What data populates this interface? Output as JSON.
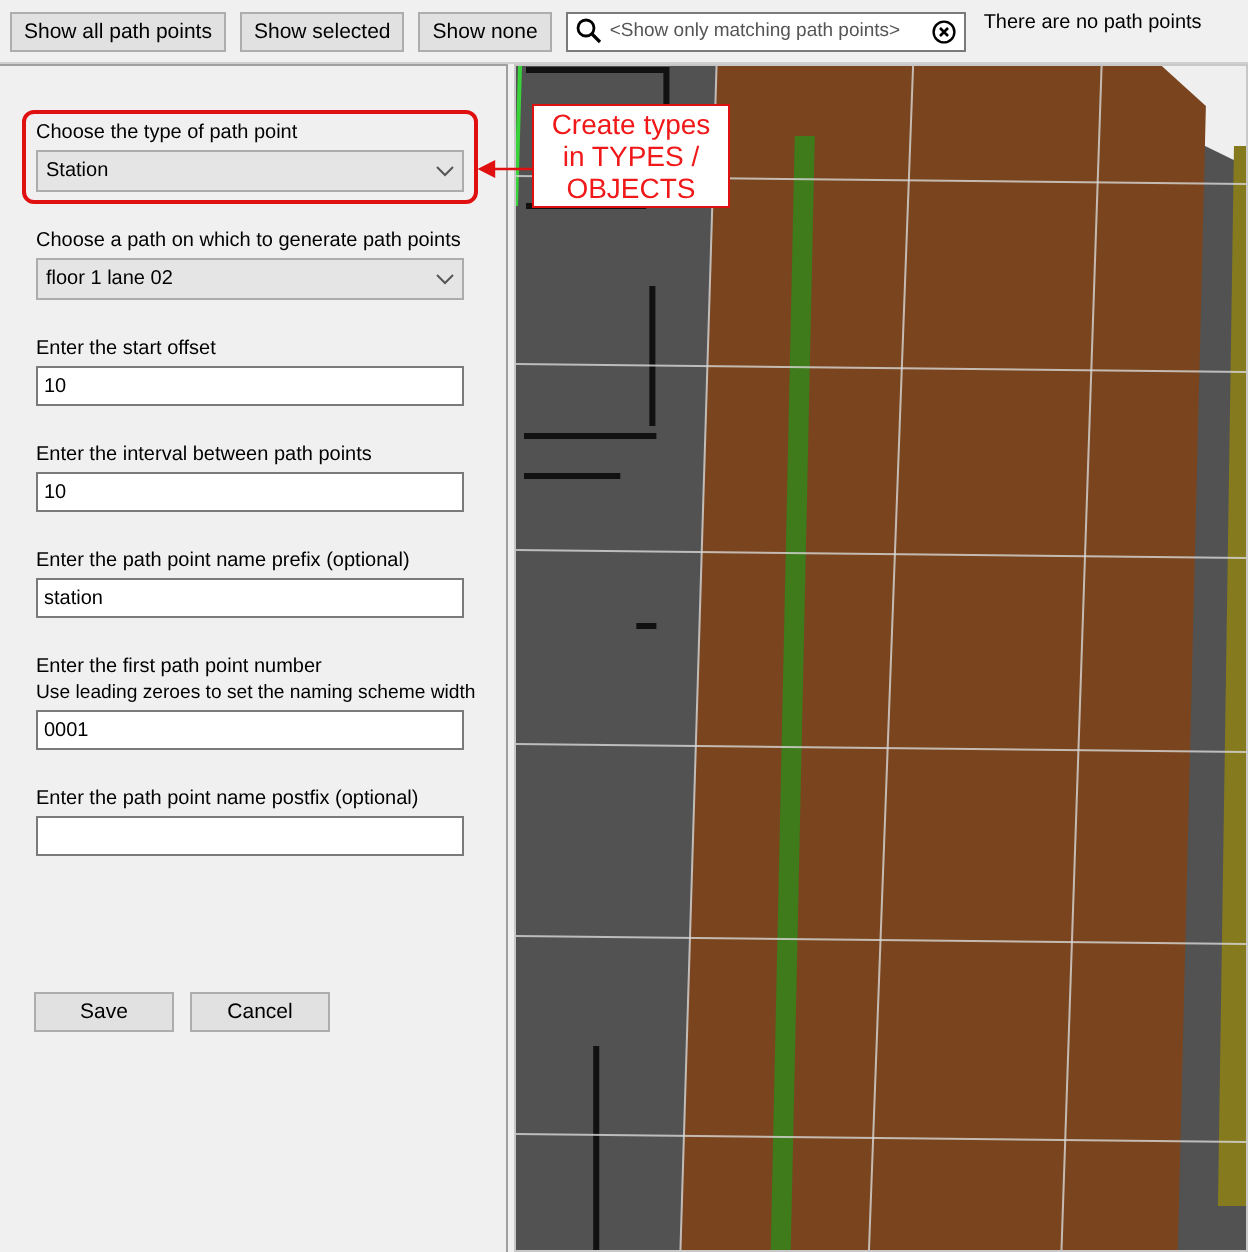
{
  "toolbar": {
    "buttons": [
      "Show all path points",
      "Show selected",
      "Show none"
    ],
    "search": {
      "placeholder": "<Show only matching path points>"
    },
    "status": "There are no path points"
  },
  "form": {
    "fields": [
      {
        "kind": "select",
        "label": "Choose the type of path point",
        "value": "Station",
        "highlighted": true
      },
      {
        "kind": "select",
        "label": "Choose a path on which to generate path points",
        "value": "floor 1 lane 02",
        "highlighted": false
      },
      {
        "kind": "text",
        "label": "Enter the start offset",
        "value": "10",
        "highlighted": false
      },
      {
        "kind": "text",
        "label": "Enter the interval between path points",
        "value": "10",
        "highlighted": false
      },
      {
        "kind": "text",
        "label": "Enter the path point name prefix (optional)",
        "value": "station",
        "highlighted": false
      },
      {
        "kind": "text",
        "label": "Enter the first path point number",
        "note": "Use leading zeroes to set the naming scheme width",
        "value": "0001",
        "highlighted": false
      },
      {
        "kind": "text",
        "label": "Enter the path point name postfix (optional)",
        "highlighted": false
      }
    ],
    "buttons": [
      "Save",
      "Cancel"
    ]
  },
  "annotation": {
    "text": "Create types in TYPES / OBJECTS"
  }
}
